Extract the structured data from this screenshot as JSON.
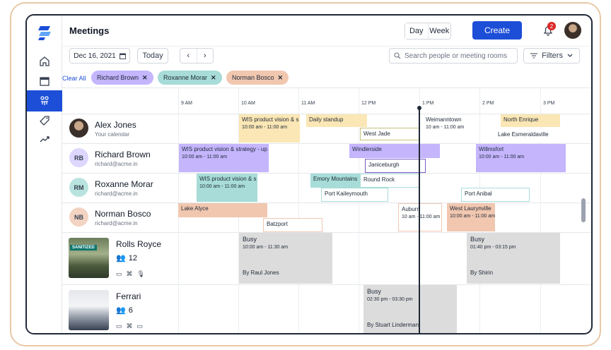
{
  "header": {
    "title": "Meetings",
    "view_day": "Day",
    "view_week": "Week",
    "create": "Create",
    "notif_count": "2"
  },
  "toolbar": {
    "date": "Dec 16, 2021",
    "today": "Today",
    "prev": "‹",
    "next": "›",
    "search_placeholder": "Search people or meeting rooms",
    "filters": "Filters"
  },
  "chips": {
    "clear_all": "Clear All",
    "items": [
      {
        "label": "Richard Brown",
        "color": "#c4b5fd"
      },
      {
        "label": "Roxanne Morar",
        "color": "#a7dcd8"
      },
      {
        "label": "Norman Bosco",
        "color": "#f1c7b0"
      }
    ]
  },
  "hours": [
    "9 AM",
    "10 AM",
    "11 AM",
    "12 PM",
    "1 PM",
    "2 PM",
    "3 PM"
  ],
  "people": [
    {
      "name": "Alex Jones",
      "sub": "Your calendar",
      "initials": ""
    },
    {
      "name": "Richard Brown",
      "sub": "richard@acme.in",
      "initials": "RB",
      "color": "#ddd6fe"
    },
    {
      "name": "Roxanne Morar",
      "sub": "richard@acme.in",
      "initials": "RM",
      "color": "#b9e3df"
    },
    {
      "name": "Norman Bosco",
      "sub": "richard@acme.in",
      "initials": "NB",
      "color": "#f3d3c2"
    }
  ],
  "rooms": [
    {
      "name": "Rolls Royce",
      "capacity": "12",
      "badge": "SANITIZED"
    },
    {
      "name": "Ferrari",
      "capacity": "6"
    }
  ],
  "events": {
    "e1": {
      "title": "WIS product vision & s",
      "time": "10:00 am - 11:00 am"
    },
    "e2": {
      "title": "Daily standup"
    },
    "e3": {
      "title": "Weimanntown",
      "time": "10 am - 11:00 am"
    },
    "e4": {
      "title": "North Enrique"
    },
    "e5": {
      "title": "West Jade"
    },
    "e6": {
      "title": "Lake Esmeraldaville"
    },
    "e7": {
      "title": "WIS product vision & strategy - up",
      "time": "10:00 am - 11:00 am"
    },
    "e8": {
      "title": "Windlerside"
    },
    "e9": {
      "title": "Willmsfort",
      "time": "10:00 am - 11:00 am"
    },
    "e10": {
      "title": "Janiceburgh"
    },
    "e11": {
      "title": "WIS product vision & s",
      "time": "10:00 am - 11:00 am"
    },
    "e12": {
      "title": "Emory Mountains"
    },
    "e13": {
      "title": "Round Rock"
    },
    "e14": {
      "title": "Port Kaileymouth"
    },
    "e15": {
      "title": "Port Anibal"
    },
    "e16": {
      "title": "Lake Alyce"
    },
    "e17": {
      "title": "Auburn",
      "time": "10 am - 11:00 am"
    },
    "e18": {
      "title": "West Laurynville",
      "time": "10:00 am - 11:00 am"
    },
    "e19": {
      "title": "Batzport"
    },
    "e20": {
      "title": "Busy",
      "time": "10:00 am - 11:30 am",
      "by": "By Raul Jones"
    },
    "e21": {
      "title": "Busy",
      "time": "01:40 pm - 03:15 pm",
      "by": "By Shirin"
    },
    "e22": {
      "title": "Busy",
      "time": "02:30 pm - 03:30 pm",
      "by": "By Stuart Linderman"
    }
  }
}
